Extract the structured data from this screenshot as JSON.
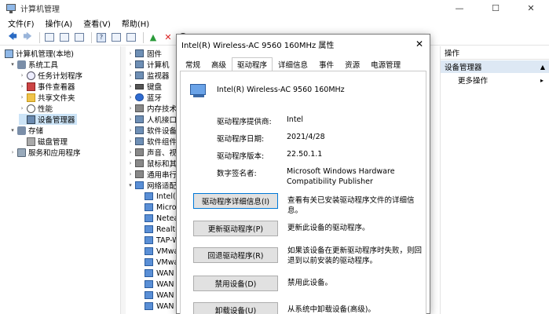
{
  "window": {
    "title": "计算机管理",
    "minimize": "—",
    "maximize": "☐",
    "close": "✕"
  },
  "menu": [
    "文件(F)",
    "操作(A)",
    "查看(V)",
    "帮助(H)"
  ],
  "toolbar": {
    "back": "🡄",
    "forward": "🡆",
    "up": "▲",
    "delete": "✕",
    "download": "⬇"
  },
  "tree": [
    {
      "label": "计算机管理(本地)",
      "toggle": "",
      "icon": "computer-icon"
    },
    {
      "label": "系统工具",
      "toggle": "▾",
      "icon": "tools-icon"
    },
    {
      "label": "任务计划程序",
      "toggle": "›",
      "icon": "clock-icon"
    },
    {
      "label": "事件查看器",
      "toggle": "›",
      "icon": "event-viewer-icon"
    },
    {
      "label": "共享文件夹",
      "toggle": "›",
      "icon": "folder-icon"
    },
    {
      "label": "性能",
      "toggle": "›",
      "icon": "performance-icon"
    },
    {
      "label": "设备管理器",
      "toggle": "",
      "icon": "device-manager-icon"
    },
    {
      "label": "存储",
      "toggle": "▾",
      "icon": "storage-icon"
    },
    {
      "label": "磁盘管理",
      "toggle": "",
      "icon": "disk-icon"
    },
    {
      "label": "服务和应用程序",
      "toggle": "›",
      "icon": "services-icon"
    }
  ],
  "devices": [
    {
      "label": "固件",
      "toggle": "›"
    },
    {
      "label": "计算机",
      "toggle": "›"
    },
    {
      "label": "监视器",
      "toggle": "›"
    },
    {
      "label": "键盘",
      "toggle": "›"
    },
    {
      "label": "蓝牙",
      "toggle": "›"
    },
    {
      "label": "内存技术设",
      "toggle": "›"
    },
    {
      "label": "人机接口设",
      "toggle": "›"
    },
    {
      "label": "软件设备",
      "toggle": "›"
    },
    {
      "label": "软件组件",
      "toggle": "›"
    },
    {
      "label": "声音、视频",
      "toggle": "›"
    },
    {
      "label": "鼠标和其他",
      "toggle": "›"
    },
    {
      "label": "通用串行总",
      "toggle": "›"
    },
    {
      "label": "网络适配器",
      "toggle": "▾"
    },
    {
      "label": "Intel(R)",
      "toggle": ""
    },
    {
      "label": "Micro",
      "toggle": ""
    },
    {
      "label": "Netea",
      "toggle": ""
    },
    {
      "label": "Realte",
      "toggle": ""
    },
    {
      "label": "TAP-W",
      "toggle": ""
    },
    {
      "label": "VMwa",
      "toggle": ""
    },
    {
      "label": "VMwa",
      "toggle": ""
    },
    {
      "label": "WAN",
      "toggle": ""
    },
    {
      "label": "WAN",
      "toggle": ""
    },
    {
      "label": "WAN",
      "toggle": ""
    },
    {
      "label": "WAN",
      "toggle": ""
    }
  ],
  "actions": {
    "header": "操作",
    "subheader": "设备管理器",
    "more": "更多操作",
    "arrow": "▲",
    "more_arrow": "▸"
  },
  "dialog": {
    "title": "Intel(R) Wireless-AC 9560 160MHz 属性",
    "close": "✕",
    "tabs": [
      "常规",
      "高级",
      "驱动程序",
      "详细信息",
      "事件",
      "资源",
      "电源管理"
    ],
    "active_tab": 2,
    "device_name": "Intel(R) Wireless-AC 9560 160MHz",
    "props": [
      {
        "label": "驱动程序提供商:",
        "value": "Intel"
      },
      {
        "label": "驱动程序日期:",
        "value": "2021/4/28"
      },
      {
        "label": "驱动程序版本:",
        "value": "22.50.1.1"
      },
      {
        "label": "数字签名者:",
        "value": "Microsoft Windows Hardware Compatibility Publisher"
      }
    ],
    "buttons": [
      {
        "label": "驱动程序详细信息(I)",
        "desc": "查看有关已安装驱动程序文件的详细信息。"
      },
      {
        "label": "更新驱动程序(P)",
        "desc": "更新此设备的驱动程序。"
      },
      {
        "label": "回退驱动程序(R)",
        "desc": "如果该设备在更新驱动程序时失败，则回退到以前安装的驱动程序。"
      },
      {
        "label": "禁用设备(D)",
        "desc": "禁用此设备。"
      },
      {
        "label": "卸载设备(U)",
        "desc": "从系统中卸载设备(高级)。"
      }
    ]
  }
}
